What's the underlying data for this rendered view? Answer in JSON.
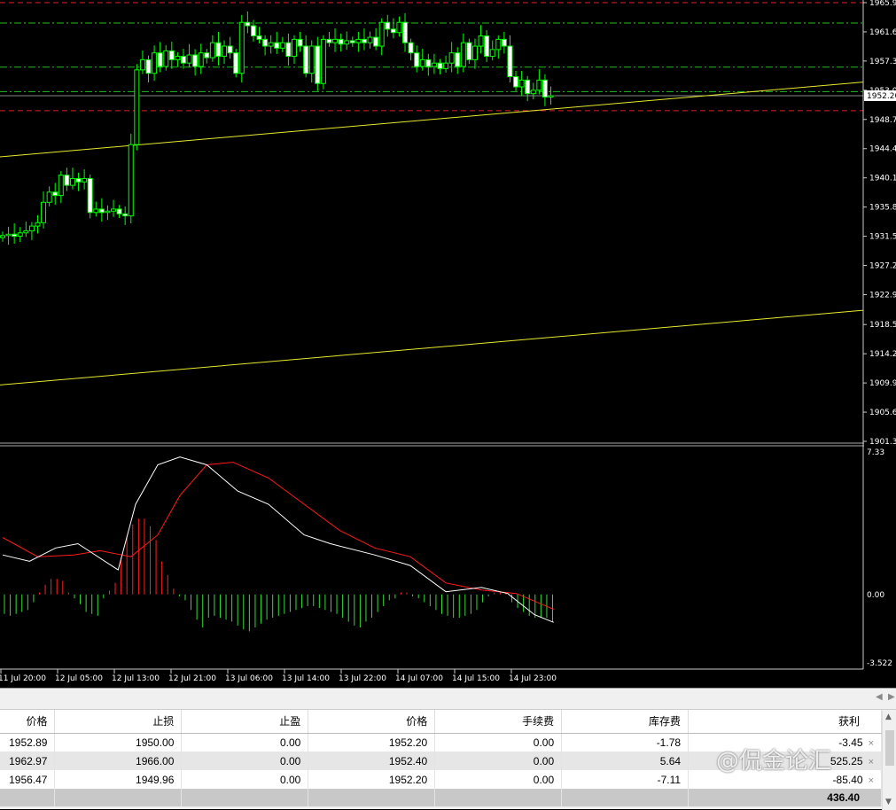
{
  "chart_data": [
    {
      "type": "candlestick",
      "name": "price-chart",
      "ylim": [
        1901.3,
        1965.9
      ],
      "y_ticks": [
        "1965.90",
        "1961.60",
        "1957.30",
        "1953.00",
        "1948.70",
        "1944.40",
        "1940.10",
        "1935.80",
        "1931.50",
        "1927.20",
        "1922.90",
        "1918.50",
        "1914.20",
        "1909.90",
        "1905.60",
        "1901.30"
      ],
      "current_price": "1952.20",
      "open_start": 1931.3,
      "closes": [
        1931.6,
        1931.8,
        1931.5,
        1932.0,
        1932.3,
        1933.0,
        1933.5,
        1936.5,
        1938.0,
        1937.5,
        1940.5,
        1939.0,
        1940.0,
        1939.5,
        1940.0,
        1935.0,
        1935.5,
        1935.0,
        1935.2,
        1935.5,
        1934.8,
        1934.5,
        1945.0,
        1956.0,
        1957.5,
        1955.5,
        1958.5,
        1956.5,
        1958.8,
        1957.5,
        1958.0,
        1957.0,
        1958.2,
        1956.5,
        1958.5,
        1957.8,
        1960.0,
        1958.0,
        1959.5,
        1958.5,
        1955.5,
        1963.0,
        1962.5,
        1961.0,
        1960.5,
        1959.5,
        1960.0,
        1959.2,
        1960.0,
        1958.0,
        1960.5,
        1959.5,
        1955.5,
        1959.5,
        1954.0,
        1960.5,
        1960.0,
        1960.5,
        1959.8,
        1960.3,
        1960.0,
        1960.5,
        1960.0,
        1960.8,
        1959.5,
        1963.0,
        1962.0,
        1961.5,
        1963.0,
        1960.0,
        1958.5,
        1956.5,
        1957.5,
        1956.5,
        1957.0,
        1956.2,
        1957.0,
        1958.5,
        1956.5,
        1960.0,
        1957.5,
        1959.5,
        1961.0,
        1958.0,
        1959.0,
        1960.5,
        1959.5,
        1955.0,
        1953.5,
        1954.5,
        1952.5,
        1953.0,
        1954.5,
        1952.0,
        1952.2
      ],
      "levels": [
        {
          "price": 1965.9,
          "color": "#e02020",
          "style": "dash"
        },
        {
          "price": 1962.9,
          "color": "#20c020",
          "style": "dashdot"
        },
        {
          "price": 1956.4,
          "color": "#20c020",
          "style": "dashdot"
        },
        {
          "price": 1952.8,
          "color": "#20c020",
          "style": "dashdot"
        },
        {
          "price": 1950.0,
          "color": "#e02020",
          "style": "dash"
        }
      ],
      "trendlines": [
        {
          "from": [
            0,
            1943.2
          ],
          "to": [
            1,
            1954.2
          ]
        },
        {
          "from": [
            0,
            1909.6
          ],
          "to": [
            1,
            1920.6
          ]
        }
      ],
      "colors": {
        "bull": "#00ff00",
        "bear": "#ffffff",
        "trend": "#e8e830"
      }
    },
    {
      "type": "macd",
      "name": "macd-indicator",
      "ylim": [
        -3.522,
        7.33
      ],
      "y_ticks": [
        "7.33",
        "0.00",
        "-3.522"
      ],
      "macd": [
        [
          0,
          2.03
        ],
        [
          4.6,
          1.71
        ],
        [
          9.1,
          2.39
        ],
        [
          12.9,
          2.61
        ],
        [
          19.8,
          1.26
        ],
        [
          22.8,
          4.64
        ],
        [
          26.6,
          6.67
        ],
        [
          30.4,
          7.07
        ],
        [
          35,
          6.67
        ],
        [
          40.3,
          5.32
        ],
        [
          45.6,
          4.64
        ],
        [
          51.7,
          3.06
        ],
        [
          56.2,
          2.61
        ],
        [
          63.8,
          2.03
        ],
        [
          69.9,
          1.49
        ],
        [
          76,
          0.14
        ],
        [
          82.1,
          0.36
        ],
        [
          86.6,
          0.05
        ],
        [
          91.2,
          -1.04
        ],
        [
          94.5,
          -1.44
        ]
      ],
      "signal": [
        [
          0,
          2.93
        ],
        [
          6,
          1.94
        ],
        [
          12.2,
          2.03
        ],
        [
          16.7,
          2.25
        ],
        [
          22,
          1.94
        ],
        [
          26.6,
          3.06
        ],
        [
          30.4,
          5.09
        ],
        [
          35,
          6.67
        ],
        [
          39.5,
          6.8
        ],
        [
          45.6,
          5.99
        ],
        [
          51.7,
          4.64
        ],
        [
          57.8,
          3.29
        ],
        [
          63.8,
          2.39
        ],
        [
          69.9,
          1.94
        ],
        [
          76,
          0.59
        ],
        [
          82.1,
          0.23
        ],
        [
          88.1,
          0.05
        ],
        [
          94.5,
          -0.77
        ]
      ],
      "histogram": [
        -1.0,
        -1.1,
        -1.0,
        -0.9,
        -0.8,
        -0.4,
        0.1,
        0.5,
        0.8,
        0.8,
        0.7,
        0.1,
        -0.2,
        -0.5,
        -0.9,
        -1.0,
        -1.1,
        -0.2,
        0.2,
        0.6,
        1.9,
        3.0,
        3.6,
        3.9,
        3.9,
        3.5,
        2.8,
        1.7,
        1.0,
        0.3,
        -0.1,
        -0.3,
        -0.8,
        -1.3,
        -1.7,
        -1.2,
        -1.1,
        -1.2,
        -1.3,
        -1.4,
        -1.6,
        -1.8,
        -1.9,
        -1.7,
        -1.5,
        -1.3,
        -1.2,
        -1.1,
        -1.0,
        -0.9,
        -0.8,
        -0.7,
        -0.6,
        -0.6,
        -0.7,
        -0.8,
        -0.9,
        -1.0,
        -1.2,
        -1.4,
        -1.6,
        -1.7,
        -1.4,
        -1.2,
        -0.9,
        -0.6,
        -0.3,
        -0.2,
        0.1,
        0.1,
        -0.1,
        -0.2,
        -0.4,
        -0.6,
        -0.8,
        -1.0,
        -1.1,
        -1.2,
        -1.2,
        -1.1,
        -1.0,
        -0.8,
        -0.4,
        -0.1,
        0.1,
        0.1,
        0.1,
        -0.4,
        -0.7,
        -0.9,
        -1.1,
        -1.2,
        -1.2,
        -1.2,
        -1.4
      ],
      "colors": {
        "macd": "#ffffff",
        "signal": "#ff1a1a",
        "pos": "#ff2020",
        "neg": "#33dd33"
      }
    }
  ],
  "time_axis": [
    "11 Jul 20:00",
    "12 Jul 05:00",
    "12 Jul 13:00",
    "12 Jul 21:00",
    "13 Jul 06:00",
    "13 Jul 14:00",
    "13 Jul 22:00",
    "14 Jul 07:00",
    "14 Jul 15:00",
    "14 Jul 23:00"
  ],
  "table": {
    "headers": [
      "价格",
      "止损",
      "止盈",
      "价格",
      "手续费",
      "库存费",
      "获利"
    ],
    "rows": [
      [
        "1952.89",
        "1950.00",
        "0.00",
        "1952.20",
        "0.00",
        "-1.78",
        "-3.45"
      ],
      [
        "1962.97",
        "1966.00",
        "0.00",
        "1952.40",
        "0.00",
        "5.64",
        "525.25"
      ],
      [
        "1956.47",
        "1949.96",
        "0.00",
        "1952.20",
        "0.00",
        "-7.11",
        "-85.40"
      ]
    ],
    "close_icon": "×",
    "total": "436.40"
  },
  "watermark": "@侃金论汇"
}
